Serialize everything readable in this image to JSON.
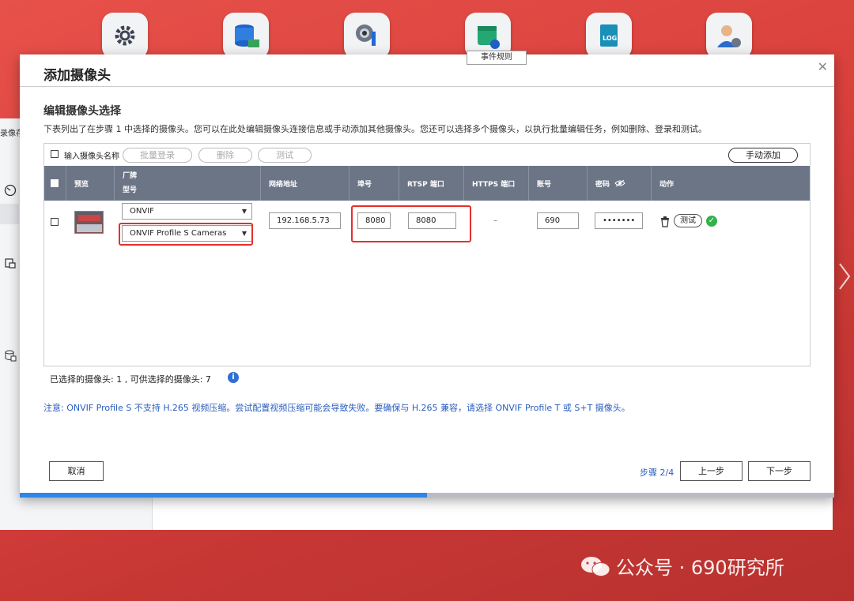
{
  "desktop": {
    "icons": [
      {
        "name": "control-panel-icon"
      },
      {
        "name": "storage-icon"
      },
      {
        "name": "camera-settings-icon"
      },
      {
        "name": "event-rules-icon"
      },
      {
        "name": "log-icon",
        "label": "LOG"
      },
      {
        "name": "user-settings-icon"
      }
    ],
    "tooltip": "事件规则",
    "bg_sidebar_title": "录像存"
  },
  "modal": {
    "title": "添加摄像头",
    "section_title": "编辑摄像头选择",
    "description": "下表列出了在步骤 1 中选择的摄像头。您可以在此处编辑摄像头连接信息或手动添加其他摄像头。您还可以选择多个摄像头，以执行批量编辑任务，例如删除、登录和测试。",
    "toolbar": {
      "name_label": "输入摄像头名称",
      "batch_login": "批量登录",
      "delete": "删除",
      "test": "测试",
      "manual_add": "手动添加"
    },
    "columns": {
      "preview": "预览",
      "brand": "厂牌",
      "model": "型号",
      "ip": "网络地址",
      "port": "埠号",
      "rtsp": "RTSP 端口",
      "https": "HTTPS 端口",
      "account": "账号",
      "password": "密码",
      "action": "动作"
    },
    "rows": [
      {
        "brand": "ONVIF",
        "model": "ONVIF Profile S Cameras",
        "ip": "192.168.5.73",
        "port": "8080",
        "rtsp": "8080",
        "https": "–",
        "account": "690",
        "password": "•••••••",
        "test": "测试"
      }
    ],
    "count_text": "已选择的摄像头:  1  , 可供选择的摄像头:  7",
    "note": "注意: ONVIF Profile S 不支持 H.265 视频压缩。尝试配置视频压缩可能会导致失败。要确保与 H.265 兼容，请选择 ONVIF Profile T 或 S+T 摄像头。",
    "cancel": "取消",
    "step": "步骤 2/4",
    "prev": "上一步",
    "next": "下一步",
    "progress": 0.5
  },
  "watermark": "公众号 · 690研究所",
  "colors": {
    "accent": "#2e86e8",
    "header": "#6c7586",
    "highlight": "#e5302b",
    "success": "#32b24a"
  }
}
